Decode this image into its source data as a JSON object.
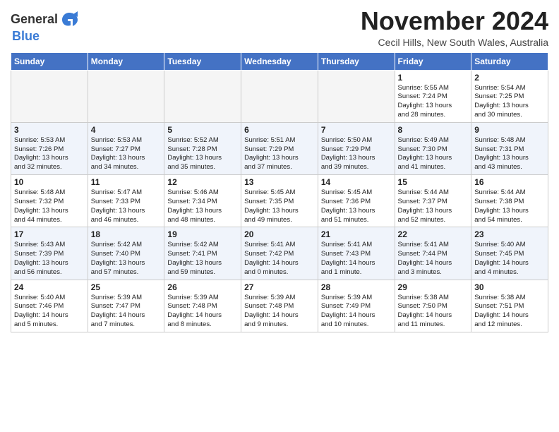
{
  "logo": {
    "general": "General",
    "blue": "Blue"
  },
  "header": {
    "title": "November 2024",
    "subtitle": "Cecil Hills, New South Wales, Australia"
  },
  "days_of_week": [
    "Sunday",
    "Monday",
    "Tuesday",
    "Wednesday",
    "Thursday",
    "Friday",
    "Saturday"
  ],
  "weeks": [
    [
      {
        "day": "",
        "info": ""
      },
      {
        "day": "",
        "info": ""
      },
      {
        "day": "",
        "info": ""
      },
      {
        "day": "",
        "info": ""
      },
      {
        "day": "",
        "info": ""
      },
      {
        "day": "1",
        "info": "Sunrise: 5:55 AM\nSunset: 7:24 PM\nDaylight: 13 hours\nand 28 minutes."
      },
      {
        "day": "2",
        "info": "Sunrise: 5:54 AM\nSunset: 7:25 PM\nDaylight: 13 hours\nand 30 minutes."
      }
    ],
    [
      {
        "day": "3",
        "info": "Sunrise: 5:53 AM\nSunset: 7:26 PM\nDaylight: 13 hours\nand 32 minutes."
      },
      {
        "day": "4",
        "info": "Sunrise: 5:53 AM\nSunset: 7:27 PM\nDaylight: 13 hours\nand 34 minutes."
      },
      {
        "day": "5",
        "info": "Sunrise: 5:52 AM\nSunset: 7:28 PM\nDaylight: 13 hours\nand 35 minutes."
      },
      {
        "day": "6",
        "info": "Sunrise: 5:51 AM\nSunset: 7:29 PM\nDaylight: 13 hours\nand 37 minutes."
      },
      {
        "day": "7",
        "info": "Sunrise: 5:50 AM\nSunset: 7:29 PM\nDaylight: 13 hours\nand 39 minutes."
      },
      {
        "day": "8",
        "info": "Sunrise: 5:49 AM\nSunset: 7:30 PM\nDaylight: 13 hours\nand 41 minutes."
      },
      {
        "day": "9",
        "info": "Sunrise: 5:48 AM\nSunset: 7:31 PM\nDaylight: 13 hours\nand 43 minutes."
      }
    ],
    [
      {
        "day": "10",
        "info": "Sunrise: 5:48 AM\nSunset: 7:32 PM\nDaylight: 13 hours\nand 44 minutes."
      },
      {
        "day": "11",
        "info": "Sunrise: 5:47 AM\nSunset: 7:33 PM\nDaylight: 13 hours\nand 46 minutes."
      },
      {
        "day": "12",
        "info": "Sunrise: 5:46 AM\nSunset: 7:34 PM\nDaylight: 13 hours\nand 48 minutes."
      },
      {
        "day": "13",
        "info": "Sunrise: 5:45 AM\nSunset: 7:35 PM\nDaylight: 13 hours\nand 49 minutes."
      },
      {
        "day": "14",
        "info": "Sunrise: 5:45 AM\nSunset: 7:36 PM\nDaylight: 13 hours\nand 51 minutes."
      },
      {
        "day": "15",
        "info": "Sunrise: 5:44 AM\nSunset: 7:37 PM\nDaylight: 13 hours\nand 52 minutes."
      },
      {
        "day": "16",
        "info": "Sunrise: 5:44 AM\nSunset: 7:38 PM\nDaylight: 13 hours\nand 54 minutes."
      }
    ],
    [
      {
        "day": "17",
        "info": "Sunrise: 5:43 AM\nSunset: 7:39 PM\nDaylight: 13 hours\nand 56 minutes."
      },
      {
        "day": "18",
        "info": "Sunrise: 5:42 AM\nSunset: 7:40 PM\nDaylight: 13 hours\nand 57 minutes."
      },
      {
        "day": "19",
        "info": "Sunrise: 5:42 AM\nSunset: 7:41 PM\nDaylight: 13 hours\nand 59 minutes."
      },
      {
        "day": "20",
        "info": "Sunrise: 5:41 AM\nSunset: 7:42 PM\nDaylight: 14 hours\nand 0 minutes."
      },
      {
        "day": "21",
        "info": "Sunrise: 5:41 AM\nSunset: 7:43 PM\nDaylight: 14 hours\nand 1 minute."
      },
      {
        "day": "22",
        "info": "Sunrise: 5:41 AM\nSunset: 7:44 PM\nDaylight: 14 hours\nand 3 minutes."
      },
      {
        "day": "23",
        "info": "Sunrise: 5:40 AM\nSunset: 7:45 PM\nDaylight: 14 hours\nand 4 minutes."
      }
    ],
    [
      {
        "day": "24",
        "info": "Sunrise: 5:40 AM\nSunset: 7:46 PM\nDaylight: 14 hours\nand 5 minutes."
      },
      {
        "day": "25",
        "info": "Sunrise: 5:39 AM\nSunset: 7:47 PM\nDaylight: 14 hours\nand 7 minutes."
      },
      {
        "day": "26",
        "info": "Sunrise: 5:39 AM\nSunset: 7:48 PM\nDaylight: 14 hours\nand 8 minutes."
      },
      {
        "day": "27",
        "info": "Sunrise: 5:39 AM\nSunset: 7:48 PM\nDaylight: 14 hours\nand 9 minutes."
      },
      {
        "day": "28",
        "info": "Sunrise: 5:39 AM\nSunset: 7:49 PM\nDaylight: 14 hours\nand 10 minutes."
      },
      {
        "day": "29",
        "info": "Sunrise: 5:38 AM\nSunset: 7:50 PM\nDaylight: 14 hours\nand 11 minutes."
      },
      {
        "day": "30",
        "info": "Sunrise: 5:38 AM\nSunset: 7:51 PM\nDaylight: 14 hours\nand 12 minutes."
      }
    ]
  ]
}
